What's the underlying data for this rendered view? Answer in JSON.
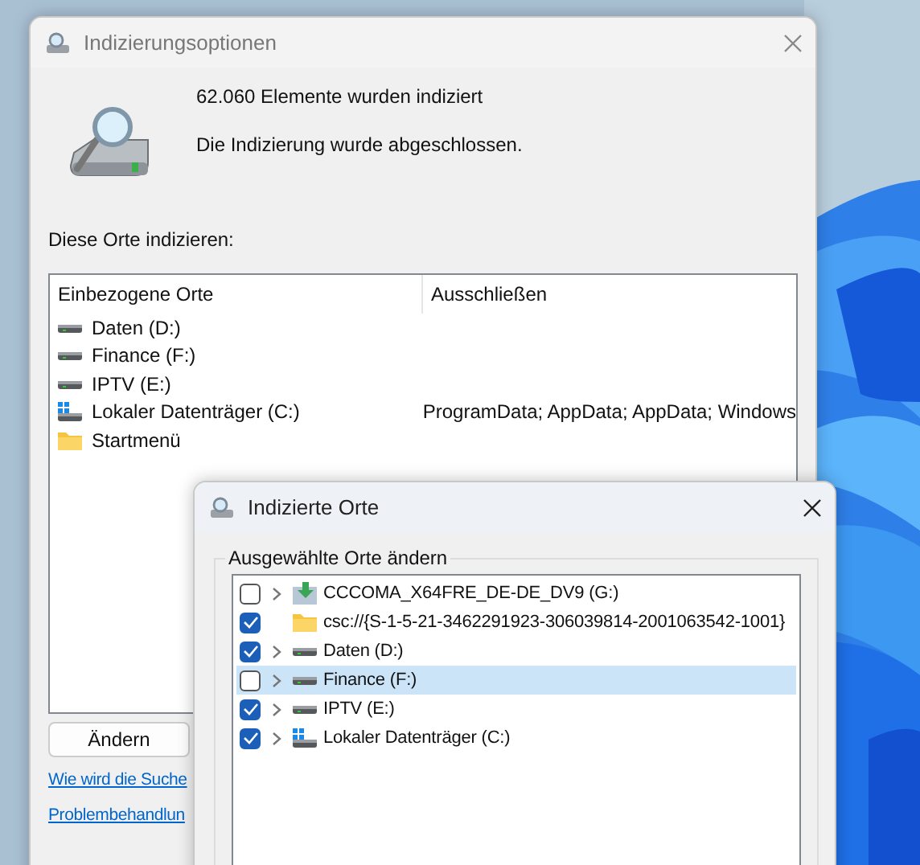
{
  "main_window": {
    "title": "Indizierungsoptionen",
    "status": [
      "62.060 Elemente wurden indiziert",
      "Die Indizierung wurde abgeschlossen."
    ],
    "list_label": "Diese Orte indizieren:",
    "table": {
      "columns": [
        "Einbezogene Orte",
        "Ausschließen"
      ],
      "rows": [
        {
          "kind": "drive",
          "location": "Daten (D:)",
          "exclude": ""
        },
        {
          "kind": "drive",
          "location": "Finance (F:)",
          "exclude": ""
        },
        {
          "kind": "drive",
          "location": "IPTV (E:)",
          "exclude": ""
        },
        {
          "kind": "system-drive",
          "location": "Lokaler Datenträger (C:)",
          "exclude": "ProgramData; AppData; AppData; Windows"
        },
        {
          "kind": "folder",
          "location": "Startmenü",
          "exclude": ""
        }
      ]
    },
    "buttons": [
      "Ändern"
    ],
    "links": [
      "Wie wird die Suche",
      "Problembehandlun"
    ]
  },
  "dialog": {
    "title": "Indizierte Orte",
    "group_label": "Ausgewählte Orte ändern",
    "tree": [
      {
        "kind": "dvd",
        "label": "CCCOMA_X64FRE_DE-DE_DV9 (G:)",
        "checked": false,
        "expandable": true,
        "selected": false
      },
      {
        "kind": "folder",
        "label": "csc://{S-1-5-21-3462291923-306039814-2001063542-1001}",
        "checked": true,
        "expandable": false,
        "selected": false
      },
      {
        "kind": "drive",
        "label": "Daten (D:)",
        "checked": true,
        "expandable": true,
        "selected": false
      },
      {
        "kind": "drive",
        "label": "Finance (F:)",
        "checked": false,
        "expandable": true,
        "selected": true
      },
      {
        "kind": "drive",
        "label": "IPTV (E:)",
        "checked": true,
        "expandable": true,
        "selected": false
      },
      {
        "kind": "system-drive",
        "label": "Lokaler Datenträger (C:)",
        "checked": true,
        "expandable": true,
        "selected": false
      }
    ]
  }
}
